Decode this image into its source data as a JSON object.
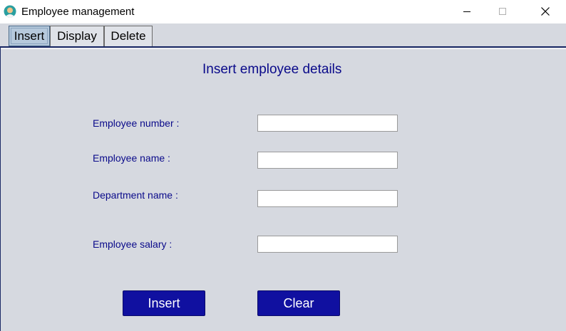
{
  "window": {
    "title": "Employee management"
  },
  "tabs": [
    {
      "label": "Insert",
      "selected": true
    },
    {
      "label": "Display",
      "selected": false
    },
    {
      "label": "Delete",
      "selected": false
    }
  ],
  "form": {
    "heading": "Insert employee details",
    "fields": [
      {
        "label": "Employee number :",
        "value": ""
      },
      {
        "label": "Employee name :",
        "value": ""
      },
      {
        "label": "Department name :",
        "value": ""
      },
      {
        "label": "Employee salary :",
        "value": ""
      }
    ]
  },
  "buttons": {
    "insert_label": "Insert",
    "clear_label": "Clear"
  },
  "colors": {
    "panel_background": "#d6d9e0",
    "accent_text": "#0a0a8a",
    "button_background": "#1010a0",
    "selected_tab": "#b6c9dc"
  },
  "icons": {
    "app": "employee-avatar-icon",
    "minimize": "minimize-icon",
    "maximize": "maximize-icon",
    "close": "close-icon"
  }
}
